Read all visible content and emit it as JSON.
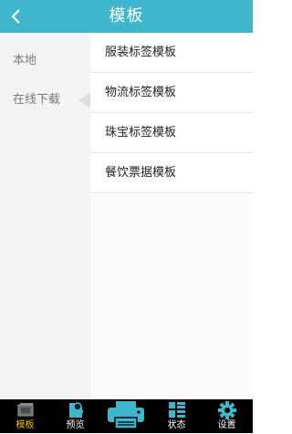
{
  "header": {
    "title": "模板",
    "back_icon": "chevron-left-icon",
    "color": "#3fb6cc"
  },
  "sidebar": {
    "items": [
      {
        "label": "本地",
        "selected": false
      },
      {
        "label": "在线下载",
        "selected": true
      }
    ]
  },
  "template_list": {
    "items": [
      {
        "label": "服装标签模板"
      },
      {
        "label": "物流标签模板"
      },
      {
        "label": "珠宝标签模板"
      },
      {
        "label": "餐饮票据模板"
      }
    ]
  },
  "tabbar": {
    "active_color": "#f5c000",
    "accent_color": "#3fb6cc",
    "tabs": [
      {
        "label": "模板",
        "icon": "template-icon",
        "active": true
      },
      {
        "label": "预览",
        "icon": "preview-icon",
        "active": false
      },
      {
        "label": "",
        "icon": "printer-icon",
        "active": false
      },
      {
        "label": "状态",
        "icon": "status-grid-icon",
        "active": false
      },
      {
        "label": "设置",
        "icon": "gear-icon",
        "active": false
      }
    ]
  }
}
